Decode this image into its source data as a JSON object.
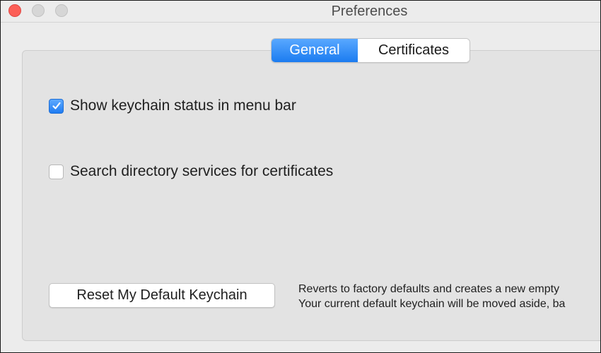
{
  "window": {
    "title": "Preferences"
  },
  "tabs": [
    {
      "label": "General",
      "active": true
    },
    {
      "label": "Certificates",
      "active": false
    }
  ],
  "options": [
    {
      "label": "Show keychain status in menu bar",
      "checked": true
    },
    {
      "label": "Search directory services for certificates",
      "checked": false
    }
  ],
  "reset": {
    "button_label": "Reset My Default Keychain",
    "description_line1": "Reverts to factory defaults and creates a new empty",
    "description_line2": "Your current default keychain will be moved aside, ba"
  },
  "colors": {
    "accent": "#1b7cf0",
    "close_button": "#fc5f57"
  }
}
